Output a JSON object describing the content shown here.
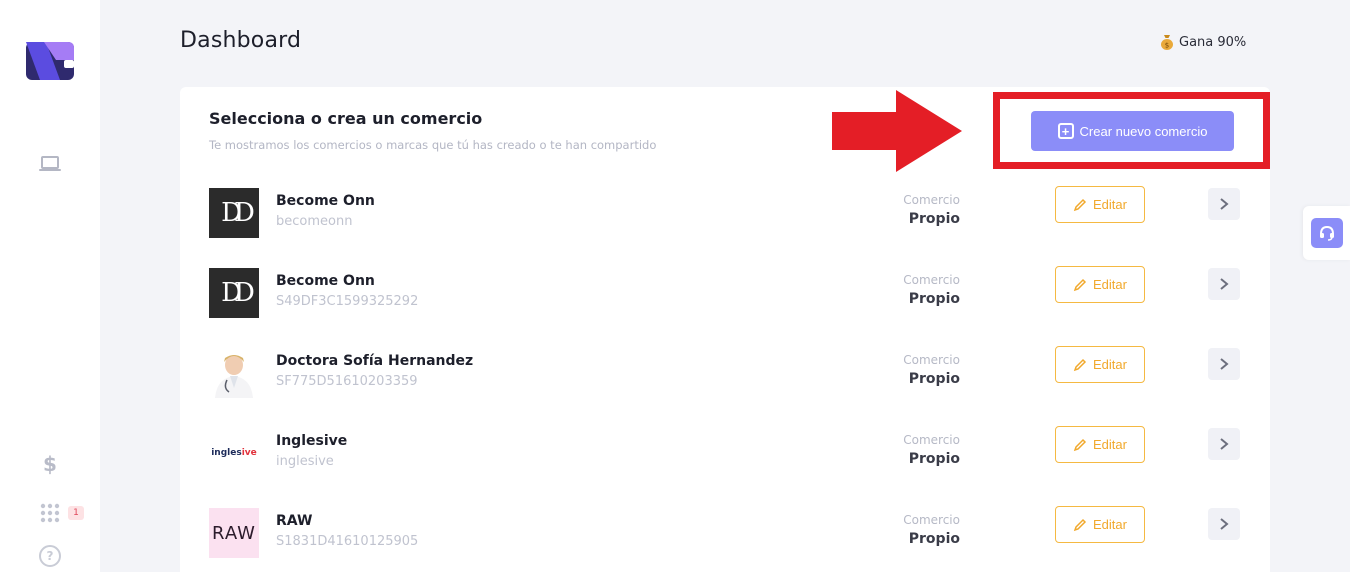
{
  "header": {
    "title": "Dashboard",
    "promo_label": "Gana 90%",
    "promo_icon": "money-bag-icon"
  },
  "sidebar": {
    "items": [
      {
        "icon": "laptop-icon"
      },
      {
        "icon": "dollar-icon",
        "glyph": "$"
      },
      {
        "icon": "apps-grid-icon",
        "badge": "1"
      },
      {
        "icon": "help-icon",
        "glyph": "?"
      }
    ]
  },
  "card": {
    "title": "Selecciona o crea un comercio",
    "subtitle": "Te mostramos los comercios o marcas que tú has creado o te han compartido",
    "create_button_label": "Crear nuevo comercio"
  },
  "businesses": [
    {
      "name": "Become Onn",
      "id": "becomeonn",
      "type_label": "Comercio",
      "type_value": "Propio",
      "edit_label": "Editar",
      "thumb": "BO"
    },
    {
      "name": "Become Onn",
      "id": "S49DF3C1599325292",
      "type_label": "Comercio",
      "type_value": "Propio",
      "edit_label": "Editar",
      "thumb": "BO"
    },
    {
      "name": "Doctora Sofía Hernandez",
      "id": "SF775D51610203359",
      "type_label": "Comercio",
      "type_value": "Propio",
      "edit_label": "Editar",
      "thumb": "doctor"
    },
    {
      "name": "Inglesive",
      "id": "inglesive",
      "type_label": "Comercio",
      "type_value": "Propio",
      "edit_label": "Editar",
      "thumb_text_a": "ingles",
      "thumb_text_b": "ive"
    },
    {
      "name": "RAW",
      "id": "S1831D41610125905",
      "type_label": "Comercio",
      "type_value": "Propio",
      "edit_label": "Editar",
      "thumb_text": "RAW"
    }
  ],
  "colors": {
    "accent": "#8b8df8",
    "highlight": "#e41e26",
    "edit": "#f1a92c"
  }
}
